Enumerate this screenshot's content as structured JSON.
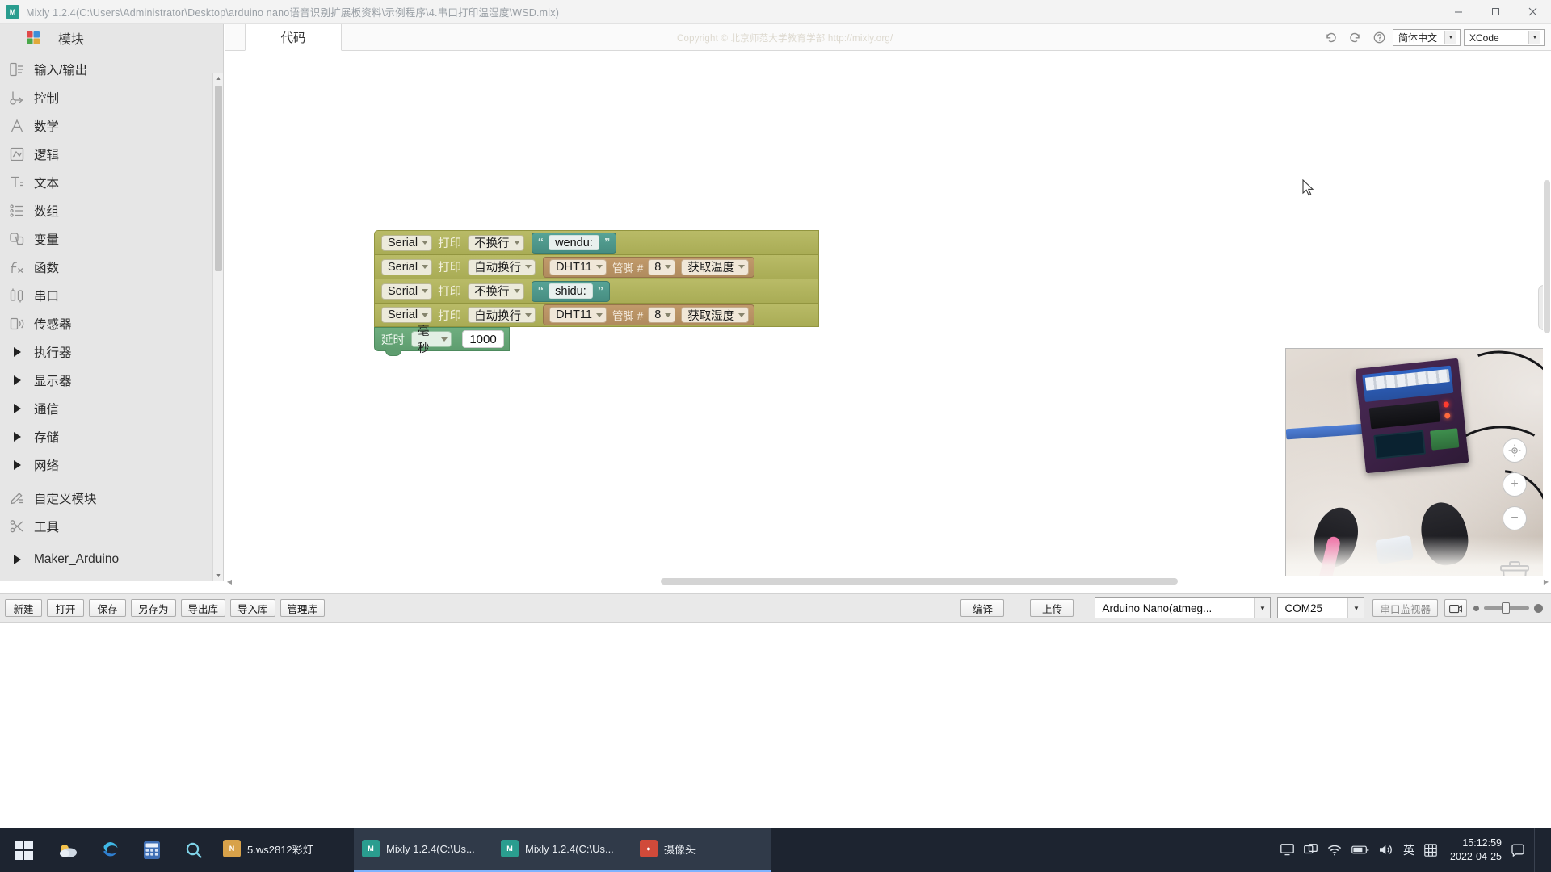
{
  "window": {
    "title": "Mixly 1.2.4(C:\\Users\\Administrator\\Desktop\\arduino nano语音识别扩展板资料\\示例程序\\4.串口打印温湿度\\WSD.mix)",
    "app_badge": "M",
    "minimize": "–",
    "maximize": "☐",
    "close": "✕"
  },
  "sidebar": {
    "header": "模块",
    "items": [
      {
        "label": "输入/输出",
        "icon": "io-icon",
        "type": "leaf"
      },
      {
        "label": "控制",
        "icon": "control-icon",
        "type": "leaf"
      },
      {
        "label": "数学",
        "icon": "math-icon",
        "type": "leaf"
      },
      {
        "label": "逻辑",
        "icon": "logic-icon",
        "type": "leaf"
      },
      {
        "label": "文本",
        "icon": "text-icon",
        "type": "leaf"
      },
      {
        "label": "数组",
        "icon": "array-icon",
        "type": "leaf"
      },
      {
        "label": "变量",
        "icon": "variable-icon",
        "type": "leaf"
      },
      {
        "label": "函数",
        "icon": "function-icon",
        "type": "leaf"
      },
      {
        "label": "串口",
        "icon": "serial-icon",
        "type": "leaf"
      },
      {
        "label": "传感器",
        "icon": "sensor-icon",
        "type": "leaf"
      },
      {
        "label": "执行器",
        "icon": "triangle-icon",
        "type": "branch"
      },
      {
        "label": "显示器",
        "icon": "triangle-icon",
        "type": "branch"
      },
      {
        "label": "通信",
        "icon": "triangle-icon",
        "type": "branch"
      },
      {
        "label": "存储",
        "icon": "triangle-icon",
        "type": "branch"
      },
      {
        "label": "网络",
        "icon": "triangle-icon",
        "type": "branch"
      },
      {
        "label": "自定义模块",
        "icon": "custom-icon",
        "type": "leaf"
      },
      {
        "label": "工具",
        "icon": "tools-icon",
        "type": "leaf"
      },
      {
        "label": "Maker_Arduino",
        "icon": "triangle-icon",
        "type": "branch"
      }
    ]
  },
  "tabs": {
    "code_tab": "代码"
  },
  "watermark": "Copyright © 北京师范大学教育学部  http://mixly.org/",
  "toolbar_top": {
    "undo_icon": "undo-icon",
    "redo_icon": "redo-icon",
    "help_icon": "help-icon",
    "language": "简体中文",
    "code_mode": "XCode"
  },
  "blocks": {
    "rows": [
      {
        "port": "Serial",
        "action": "打印",
        "newline": "不换行",
        "value_type": "text",
        "text": "wendu:"
      },
      {
        "port": "Serial",
        "action": "打印",
        "newline": "自动换行",
        "value_type": "dht",
        "sensor": "DHT11",
        "pin_label": "管脚 #",
        "pin": "8",
        "read": "获取温度"
      },
      {
        "port": "Serial",
        "action": "打印",
        "newline": "不换行",
        "value_type": "text",
        "text": "shidu:"
      },
      {
        "port": "Serial",
        "action": "打印",
        "newline": "自动换行",
        "value_type": "dht",
        "sensor": "DHT11",
        "pin_label": "管脚 #",
        "pin": "8",
        "read": "获取湿度"
      }
    ],
    "delay": {
      "label": "延时",
      "unit": "毫秒",
      "value": "1000"
    }
  },
  "colors": {
    "serial_block": "#b0b35c",
    "text_block": "#4d968a",
    "dht_block": "#b9914f",
    "delay_block": "#62a173",
    "taskbar": "#1d2430",
    "accent": "#7fb3ff"
  },
  "bottom_toolbar": {
    "buttons": [
      "新建",
      "打开",
      "保存",
      "另存为",
      "导出库",
      "导入库",
      "管理库"
    ],
    "compile": "编译",
    "upload": "上传",
    "board": "Arduino Nano(atmeg...",
    "port": "COM25",
    "serial_monitor": "串口监视器",
    "camera_icon": "camera-icon"
  },
  "taskbar": {
    "start_icon": "windows-start-icon",
    "pinned": [
      "weather-icon",
      "edge-icon",
      "calculator-icon",
      "search-icon"
    ],
    "apps": [
      {
        "name": "5.ws2812彩灯",
        "icon": "notepad-icon",
        "badge": "N",
        "badge_color": "#d8a24a",
        "active": false
      },
      {
        "name": "Mixly 1.2.4(C:\\Us...",
        "icon": "mixly-icon",
        "badge": "M",
        "badge_color": "#2a9d8f",
        "active": true
      },
      {
        "name": "Mixly 1.2.4(C:\\Us...",
        "icon": "mixly-icon",
        "badge": "M",
        "badge_color": "#2a9d8f",
        "active": true
      },
      {
        "name": "摄像头",
        "icon": "camera-app-icon",
        "badge": "●",
        "badge_color": "#d04a3a",
        "active": true
      }
    ],
    "tray_icons": [
      "monitor-icon",
      "display-icon",
      "wifi-icon",
      "battery-icon",
      "volume-icon",
      "grid-icon",
      "notification-icon"
    ],
    "ime": "英",
    "time": "15:12:59",
    "date": "2022-04-25"
  }
}
